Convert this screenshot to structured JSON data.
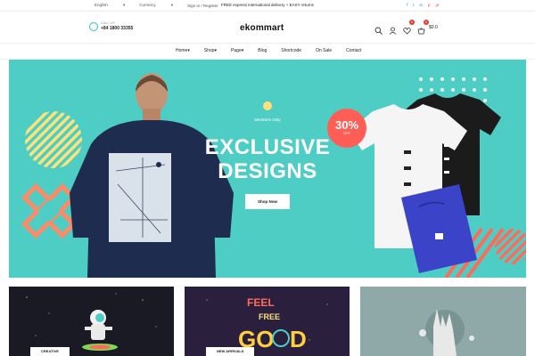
{
  "topbar": {
    "language": "English",
    "currency": "Currency",
    "auth": "Sign In / Register",
    "notice": "FREE express international delivery + EASY returns",
    "social": [
      "f",
      "t",
      "in",
      "p",
      "yt"
    ]
  },
  "header": {
    "call_label": "CALL US",
    "phone": "+84 1800 33355",
    "logo": "ekommart",
    "wishlist_count": "0",
    "cart_count": "0",
    "cart_total": "$0.0"
  },
  "nav": {
    "items": [
      "Home",
      "Shop",
      "Page",
      "Blog",
      "Shortcode",
      "On Sale",
      "Contact"
    ]
  },
  "hero": {
    "subtitle": "Members Only",
    "title_line1": "EXCLUSIVE",
    "title_line2": "DESIGNS",
    "button": "Shop Now",
    "discount": "30%",
    "discount_label": "OFF"
  },
  "cards": {
    "card1_tag": "CREATIVE",
    "card2_tag": "NEW ARRIVALS"
  },
  "colors": {
    "accent": "#4ecdc4",
    "sale": "#ff5e57",
    "dark_card": "#1f1f2e"
  }
}
